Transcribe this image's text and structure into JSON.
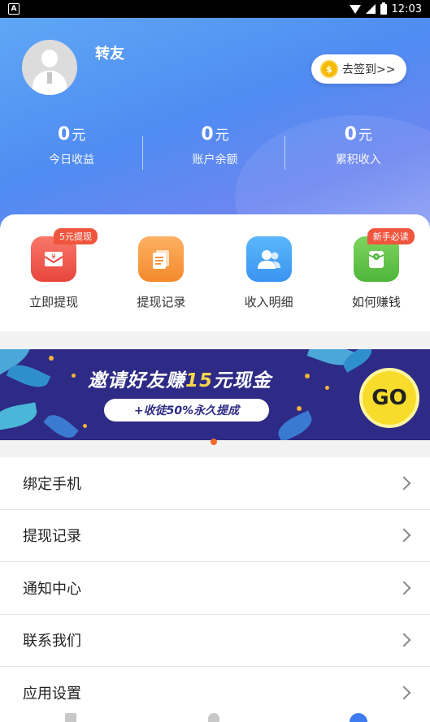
{
  "status_bar": {
    "time": "12:03",
    "left_icon": "A"
  },
  "profile": {
    "username": "转友",
    "checkin_label": "去签到>>",
    "coin_symbol": "$"
  },
  "stats": [
    {
      "value": "0",
      "unit": "元",
      "label": "今日收益"
    },
    {
      "value": "0",
      "unit": "元",
      "label": "账户余额"
    },
    {
      "value": "0",
      "unit": "元",
      "label": "累积收入"
    }
  ],
  "quick_actions": [
    {
      "label": "立即提现",
      "badge": "5元提现",
      "icon": "withdraw-envelope-icon"
    },
    {
      "label": "提现记录",
      "badge": "",
      "icon": "document-icon"
    },
    {
      "label": "收入明细",
      "badge": "",
      "icon": "users-icon"
    },
    {
      "label": "如何赚钱",
      "badge": "新手必读",
      "icon": "money-bag-icon"
    }
  ],
  "banner": {
    "title_prefix": "邀请好友赚",
    "title_amount": "15",
    "title_suffix": "元现金",
    "subtitle": "+收徒50%永久提成",
    "go_label": "GO"
  },
  "menu": [
    {
      "label": "绑定手机"
    },
    {
      "label": "提现记录"
    },
    {
      "label": "通知中心"
    },
    {
      "label": "联系我们"
    },
    {
      "label": "应用设置"
    }
  ],
  "colors": {
    "header_gradient_start": "#5fa7f5",
    "header_gradient_end": "#8fa2f6",
    "banner_bg": "#2d2b86",
    "badge_red": "#f0553e",
    "go_yellow": "#f8dc2c"
  }
}
